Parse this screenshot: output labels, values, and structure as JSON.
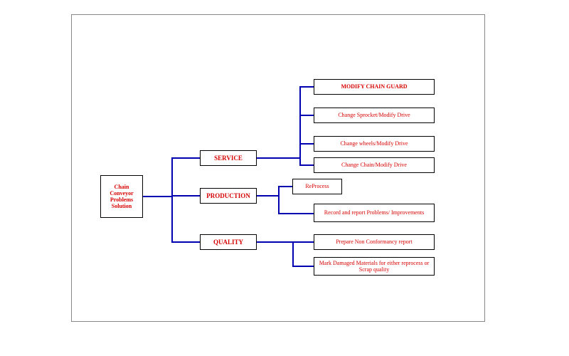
{
  "diagram": {
    "root": "Chain Conveyor Problems Solution",
    "categories": {
      "service": "SERVICE",
      "production": "PRODUCTION",
      "quality": "QUALITY"
    },
    "leaves": {
      "modify_chain_guard": "MODIFY CHAIN GUARD",
      "change_sprocket": "Change Sprocket/Modify Drive",
      "change_wheels": "Change wheels/Modify Drive",
      "change_chain": "Change Chain/Modify Drive",
      "reprocess": "ReProcess",
      "record_report": "Record and report Problems/ Improvements",
      "prepare_ncr": "Prepare Non Conformancy report",
      "mark_damaged": "Mark Damaged Materials for either reprocess or Scrap quality"
    }
  },
  "chart_data": {
    "type": "tree",
    "title": "Chain Conveyor Problems Solution",
    "root": {
      "label": "Chain Conveyor Problems Solution",
      "children": [
        {
          "label": "SERVICE",
          "children": [
            {
              "label": "MODIFY CHAIN GUARD"
            },
            {
              "label": "Change Sprocket/Modify Drive"
            },
            {
              "label": "Change wheels/Modify Drive"
            },
            {
              "label": "Change Chain/Modify Drive"
            }
          ]
        },
        {
          "label": "PRODUCTION",
          "children": [
            {
              "label": "ReProcess"
            },
            {
              "label": "Record and report Problems/ Improvements"
            }
          ]
        },
        {
          "label": "QUALITY",
          "children": [
            {
              "label": "Prepare Non Conformancy report"
            },
            {
              "label": "Mark Damaged Materials for either reprocess or Scrap quality"
            }
          ]
        }
      ]
    }
  }
}
